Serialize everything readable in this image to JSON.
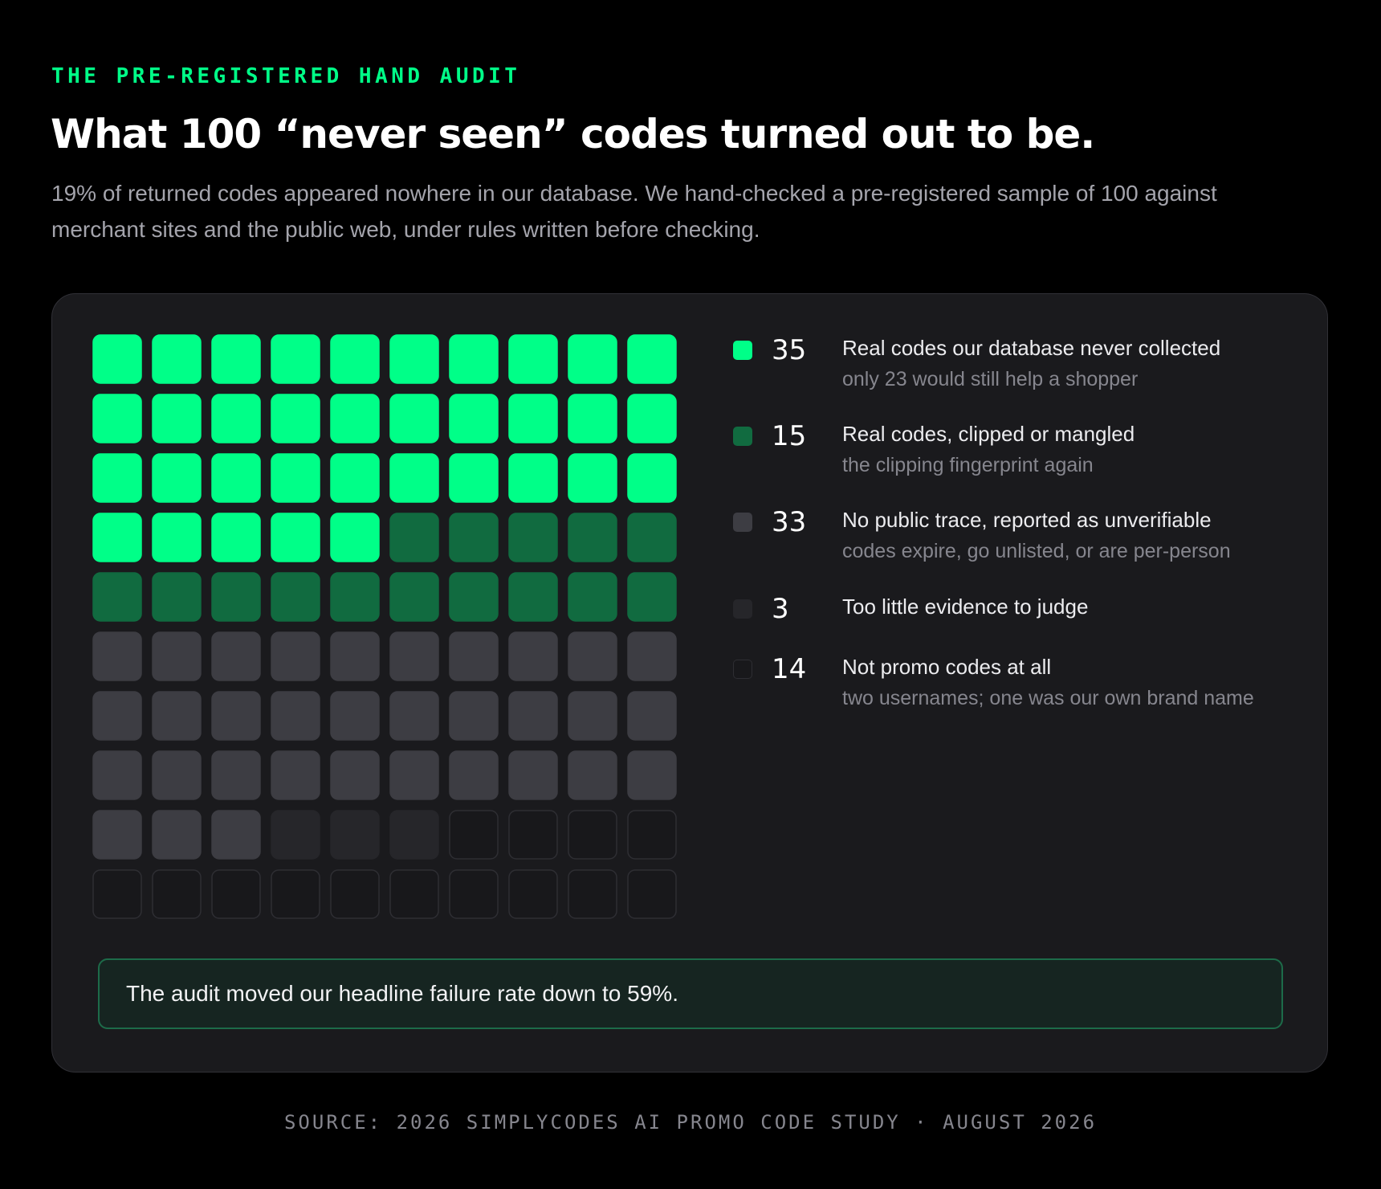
{
  "header": {
    "eyebrow": "THE PRE-REGISTERED HAND AUDIT",
    "title": "What 100 “never seen” codes turned out to be.",
    "subtitle": "19% of returned codes appeared nowhere in our database. We hand-checked a pre-registered sample of 100 against merchant sites and the public web, under rules written before checking."
  },
  "chart_data": {
    "type": "waffle",
    "total": 100,
    "grid": {
      "columns": 10,
      "rows": 10
    },
    "categories": [
      {
        "count": 35,
        "label": "Real codes our database never collected",
        "note": "only 23 would still help a shopper",
        "color": "#00ff88",
        "border": "#00ff88"
      },
      {
        "count": 15,
        "label": "Real codes, clipped or mangled",
        "note": "the clipping fingerprint again",
        "color": "#116b40",
        "border": "#116b40"
      },
      {
        "count": 33,
        "label": "No public trace, reported as unverifiable",
        "note": "codes expire, go unlisted, or are per-person",
        "color": "#3d3d43",
        "border": "#3d3d43"
      },
      {
        "count": 3,
        "label": "Too little evidence to judge",
        "note": "",
        "color": "#26262a",
        "border": "#26262a"
      },
      {
        "count": 14,
        "label": "Not promo codes at all",
        "note": "two usernames; one was our own brand name",
        "color": "#18181b",
        "border": "#2e2e33"
      }
    ]
  },
  "callout": {
    "text": "The audit moved our headline failure rate down to 59%."
  },
  "footer": {
    "source": "SOURCE: 2026 SIMPLYCODES AI PROMO CODE STUDY · AUGUST 2026"
  }
}
